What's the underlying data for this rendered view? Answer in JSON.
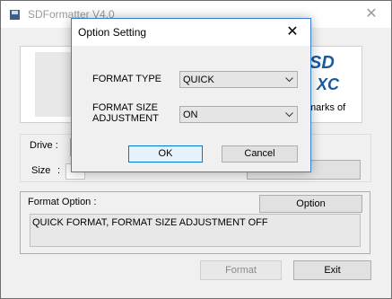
{
  "window": {
    "title": "SDFormatter V4.0",
    "close_glyph": "✕"
  },
  "logo": {
    "brand_line1": "SD",
    "brand_line2": "XC",
    "trademark_text": "marks of"
  },
  "drive_panel": {
    "drive_label": "Drive :",
    "size_label": "Size"
  },
  "format_option": {
    "label": "Format Option :",
    "option_button": "Option",
    "summary": "QUICK FORMAT, FORMAT SIZE ADJUSTMENT OFF"
  },
  "actions": {
    "format_button": "Format",
    "exit_button": "Exit"
  },
  "dialog": {
    "title": "Option Setting",
    "close_glyph": "✕",
    "format_type_label": "FORMAT TYPE",
    "format_type_value": "QUICK",
    "format_size_label_line1": "FORMAT SIZE",
    "format_size_label_line2": "ADJUSTMENT",
    "format_size_value": "ON",
    "ok_button": "OK",
    "cancel_button": "Cancel"
  },
  "colors": {
    "accent": "#0078d7",
    "sdxc_blue": "#1a5aa3"
  }
}
